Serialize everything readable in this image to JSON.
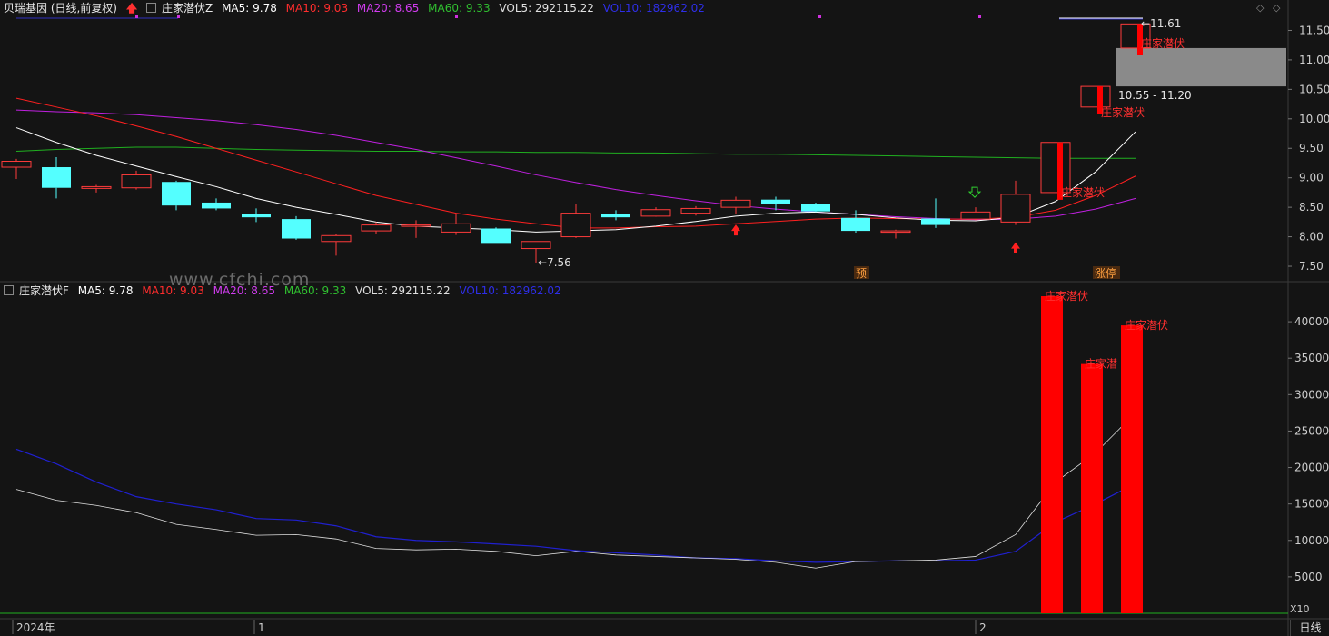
{
  "header": {
    "stock": "贝瑞基因 (日线,前复权)",
    "indicator": "庄家潜伏Z",
    "ma5": "MA5: 9.78",
    "ma10": "MA10: 9.03",
    "ma20": "MA20: 8.65",
    "ma60": "MA60: 9.33",
    "vol5": "VOL5: 292115.22",
    "vol10": "VOL10: 182962.02"
  },
  "sub_header": {
    "indicator": "庄家潜伏F",
    "ma5": "MA5: 9.78",
    "ma10": "MA10: 9.03",
    "ma20": "MA20: 8.65",
    "ma60": "MA60: 9.33",
    "vol5": "VOL5: 292115.22",
    "vol10": "VOL10: 182962.02"
  },
  "watermark": "www.cfchi.com",
  "footer": {
    "period": "日线",
    "scale": "X10"
  },
  "colors": {
    "up": "#ff3b3b",
    "down": "#54ffff",
    "ma5": "#ffffff",
    "ma10": "#ff2020",
    "ma20": "#c020e0",
    "ma60": "#20b020",
    "vol10": "#2020d0",
    "bar": "#ff0000"
  },
  "icons": {
    "up_arrow": "up-arrow-icon",
    "down_arrow": "down-arrow-icon",
    "diamond": "diamond-icon"
  },
  "chart_data": {
    "type": "candlestick",
    "x_labels": [
      "2024年",
      "1",
      "2"
    ],
    "price_axis": {
      "ylim": [
        7.3,
        11.8
      ],
      "ticks": [
        "11.50",
        "11.00",
        "10.50",
        "10.00",
        "9.50",
        "9.00",
        "8.50",
        "8.00",
        "7.50"
      ]
    },
    "candles": [
      {
        "o": 9.18,
        "h": 9.32,
        "l": 8.98,
        "c": 9.28
      },
      {
        "o": 9.18,
        "h": 9.35,
        "l": 8.65,
        "c": 8.83
      },
      {
        "o": 8.82,
        "h": 8.88,
        "l": 8.75,
        "c": 8.85
      },
      {
        "o": 8.83,
        "h": 9.12,
        "l": 8.8,
        "c": 9.05
      },
      {
        "o": 8.93,
        "h": 8.95,
        "l": 8.45,
        "c": 8.53
      },
      {
        "o": 8.58,
        "h": 8.65,
        "l": 8.45,
        "c": 8.48
      },
      {
        "o": 8.38,
        "h": 8.48,
        "l": 8.25,
        "c": 8.33
      },
      {
        "o": 8.3,
        "h": 8.35,
        "l": 7.95,
        "c": 7.97
      },
      {
        "o": 7.92,
        "h": 8.05,
        "l": 7.68,
        "c": 8.02
      },
      {
        "o": 8.1,
        "h": 8.25,
        "l": 8.05,
        "c": 8.2
      },
      {
        "o": 8.18,
        "h": 8.28,
        "l": 7.98,
        "c": 8.2
      },
      {
        "o": 8.08,
        "h": 8.4,
        "l": 8.03,
        "c": 8.22
      },
      {
        "o": 8.14,
        "h": 8.16,
        "l": 7.88,
        "c": 7.88
      },
      {
        "o": 7.8,
        "h": 7.9,
        "l": 7.56,
        "c": 7.92
      },
      {
        "o": 8.0,
        "h": 8.55,
        "l": 7.98,
        "c": 8.4
      },
      {
        "o": 8.38,
        "h": 8.45,
        "l": 8.28,
        "c": 8.33
      },
      {
        "o": 8.35,
        "h": 8.5,
        "l": 8.34,
        "c": 8.46
      },
      {
        "o": 8.4,
        "h": 8.52,
        "l": 8.36,
        "c": 8.48
      },
      {
        "o": 8.5,
        "h": 8.68,
        "l": 8.38,
        "c": 8.62
      },
      {
        "o": 8.63,
        "h": 8.68,
        "l": 8.45,
        "c": 8.55
      },
      {
        "o": 8.56,
        "h": 8.58,
        "l": 8.42,
        "c": 8.43
      },
      {
        "o": 8.32,
        "h": 8.45,
        "l": 8.07,
        "c": 8.1
      },
      {
        "o": 8.08,
        "h": 8.12,
        "l": 7.97,
        "c": 8.1
      },
      {
        "o": 8.31,
        "h": 8.65,
        "l": 8.15,
        "c": 8.2
      },
      {
        "o": 8.3,
        "h": 8.5,
        "l": 8.28,
        "c": 8.42
      },
      {
        "o": 8.25,
        "h": 8.95,
        "l": 8.2,
        "c": 8.72
      },
      {
        "o": 8.75,
        "h": 9.6,
        "l": 8.75,
        "c": 9.6
      },
      {
        "o": 10.2,
        "h": 10.55,
        "l": 10.2,
        "c": 10.55
      },
      {
        "o": 11.2,
        "h": 11.61,
        "l": 11.2,
        "c": 11.61
      }
    ],
    "ma5": [
      9.85,
      9.6,
      9.38,
      9.2,
      9.02,
      8.85,
      8.65,
      8.5,
      8.38,
      8.25,
      8.18,
      8.15,
      8.12,
      8.08,
      8.1,
      8.12,
      8.18,
      8.26,
      8.35,
      8.4,
      8.42,
      8.38,
      8.32,
      8.28,
      8.27,
      8.33,
      8.6,
      9.1,
      9.78
    ],
    "ma10": [
      10.35,
      10.2,
      10.05,
      9.88,
      9.7,
      9.5,
      9.3,
      9.1,
      8.9,
      8.7,
      8.55,
      8.4,
      8.3,
      8.22,
      8.15,
      8.15,
      8.17,
      8.18,
      8.22,
      8.26,
      8.3,
      8.32,
      8.31,
      8.3,
      8.3,
      8.33,
      8.45,
      8.7,
      9.03
    ],
    "ma20": [
      10.15,
      10.12,
      10.1,
      10.07,
      10.02,
      9.97,
      9.9,
      9.82,
      9.72,
      9.6,
      9.48,
      9.34,
      9.2,
      9.05,
      8.92,
      8.8,
      8.7,
      8.61,
      8.53,
      8.47,
      8.42,
      8.38,
      8.34,
      8.31,
      8.29,
      8.3,
      8.35,
      8.47,
      8.65
    ],
    "ma60": [
      9.45,
      9.48,
      9.5,
      9.52,
      9.52,
      9.5,
      9.48,
      9.47,
      9.46,
      9.45,
      9.45,
      9.44,
      9.44,
      9.43,
      9.43,
      9.42,
      9.42,
      9.41,
      9.4,
      9.4,
      9.39,
      9.38,
      9.37,
      9.36,
      9.35,
      9.34,
      9.33,
      9.33,
      9.33
    ],
    "annotations": {
      "low": "←7.56",
      "high": "←11.61",
      "range": "10.55 - 11.20",
      "signal": "庄家潜伏",
      "pre_tag": "预",
      "limit_tag": "涨停"
    },
    "volume_axis": {
      "ylim": [
        0,
        44000
      ],
      "ticks": [
        "40000",
        "35000",
        "30000",
        "25000",
        "20000",
        "15000",
        "10000",
        "5000"
      ]
    },
    "volume_line_white": [
      17000,
      15500,
      14800,
      13800,
      12200,
      11500,
      10700,
      10800,
      10200,
      8900,
      8700,
      8800,
      8500,
      7900,
      8500,
      8000,
      7800,
      7600,
      7400,
      7000,
      6200,
      7100,
      7200,
      7300,
      7800,
      10800,
      18000,
      22000,
      27500
    ],
    "volume_line_blue": [
      22500,
      20500,
      18000,
      16000,
      15000,
      14200,
      13000,
      12800,
      12000,
      10500,
      10000,
      9800,
      9500,
      9200,
      8600,
      8300,
      8000,
      7600,
      7500,
      7200,
      7000,
      7100,
      7200,
      7200,
      7300,
      8500,
      12500,
      15000,
      17800
    ],
    "volume_bars": [
      {
        "i": 26,
        "v": 43500,
        "label": "庄家潜伏"
      },
      {
        "i": 27,
        "v": 34200,
        "label": "庄家潜"
      },
      {
        "i": 28,
        "v": 39500,
        "label": "庄家潜伏"
      }
    ]
  }
}
